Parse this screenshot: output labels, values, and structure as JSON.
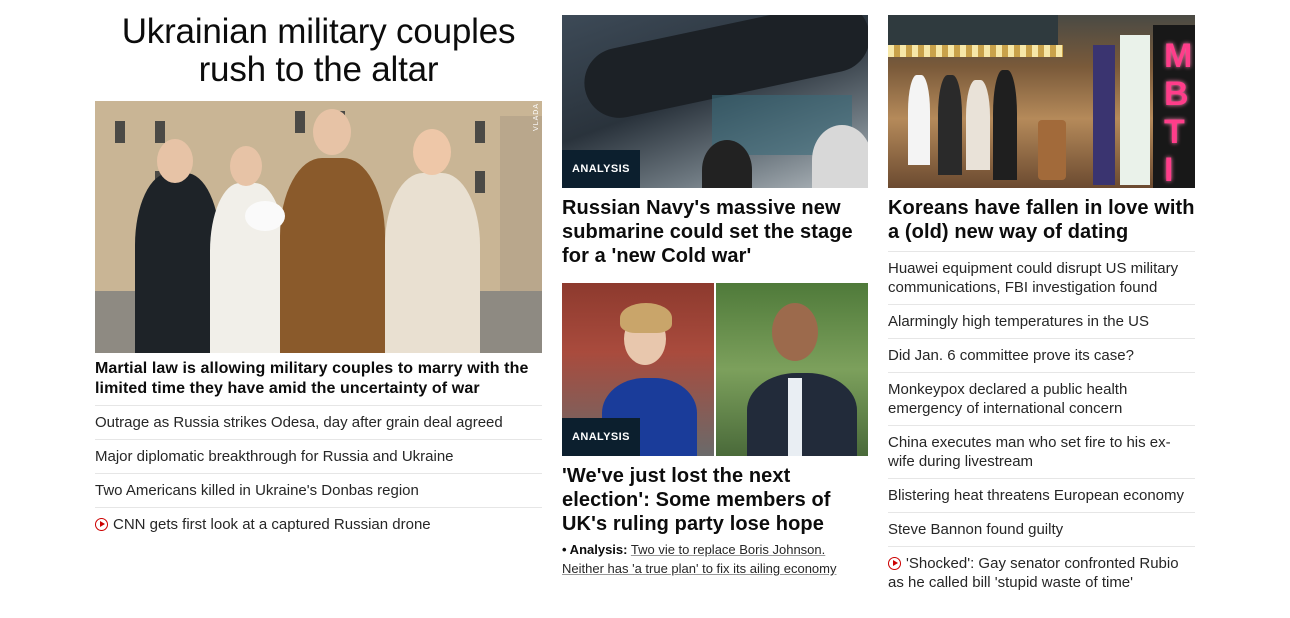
{
  "col1": {
    "title": "Ukrainian military couples rush to the altar",
    "image_credit": "VLADA",
    "lead_headline": "Martial law is allowing military couples to marry with the limited time they have amid the uncertainty of war",
    "items": [
      {
        "text": "Outrage as Russia strikes Odesa, day after grain deal agreed",
        "video": false
      },
      {
        "text": "Major diplomatic breakthrough for Russia and Ukraine",
        "video": false
      },
      {
        "text": "Two Americans killed in Ukraine's Donbas region",
        "video": false
      },
      {
        "text": "CNN gets first look at a captured Russian drone",
        "video": true
      }
    ]
  },
  "col2": {
    "card1": {
      "badge": "ANALYSIS",
      "headline": "Russian Navy's massive new submarine could set the stage for a 'new Cold war'"
    },
    "card2": {
      "badge": "ANALYSIS",
      "headline": "'We've just lost the next election': Some members of UK's ruling party lose hope",
      "sub_label": "• Analysis:",
      "sub_text": "Two vie to replace Boris Johnson. Neither has 'a true plan' to fix its ailing economy"
    }
  },
  "col3": {
    "headline": "Koreans have fallen in love with a (old) new way of dating",
    "sign_letters": "MBTI",
    "items": [
      {
        "text": "Huawei equipment could disrupt US military communications, FBI investigation found",
        "video": false
      },
      {
        "text": "Alarmingly high temperatures in the US",
        "video": false
      },
      {
        "text": "Did Jan. 6 committee prove its case?",
        "video": false
      },
      {
        "text": "Monkeypox declared a public health emergency of international concern",
        "video": false
      },
      {
        "text": "China executes man who set fire to his ex-wife during livestream",
        "video": false
      },
      {
        "text": "Blistering heat threatens European economy",
        "video": false
      },
      {
        "text": "Steve Bannon found guilty",
        "video": false
      },
      {
        "text": "'Shocked': Gay senator confronted Rubio as he called bill 'stupid waste of time'",
        "video": true
      }
    ]
  },
  "colors": {
    "badge_bg": "#0c1f2e",
    "video_icon": "#cc0000",
    "divider": "#e6e6e6"
  }
}
